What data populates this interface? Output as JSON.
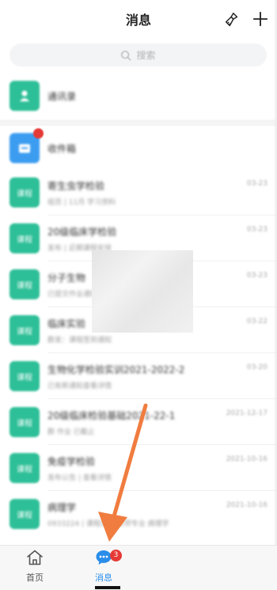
{
  "header": {
    "title": "消息"
  },
  "search": {
    "placeholder": "搜索"
  },
  "contacts": {
    "title": "通讯录"
  },
  "files": {
    "title": "收件箱"
  },
  "groups": [
    {
      "title": "寄生虫学检验",
      "sub": "组员 | 11月 学习资料",
      "date": "03-23",
      "icon_text": "课程"
    },
    {
      "title": "20级临床学检验",
      "sub": "发布 | 近期课程安排",
      "date": "03-23",
      "icon_text": "课程"
    },
    {
      "title": "分子生物",
      "sub": "已提交作业通知",
      "date": "03-23",
      "icon_text": "课程"
    },
    {
      "title": "临床实验",
      "sub": "群发：课程签到通知",
      "date": "03-22",
      "icon_text": "课程"
    },
    {
      "title": "生物化学检验实训2021-2022-2",
      "sub": "已有新通知查看详情",
      "date": "03-20",
      "icon_text": "课程"
    },
    {
      "title": "20级临床检验基础2021-22-1",
      "sub": "群 作业 已截止",
      "date": "2021-12-17",
      "icon_text": "课程"
    },
    {
      "title": "免疫学检验",
      "sub": "发布公告 | 查看详情",
      "date": "2021-10-16",
      "icon_text": "课程"
    },
    {
      "title": "病理学",
      "sub": "0933224 | 课程资料 老师专业 病理学",
      "date": "2021-10-16",
      "icon_text": "课程"
    }
  ],
  "tabbar": {
    "home_label": "首页",
    "msg_label": "消息",
    "msg_badge": "3"
  },
  "colors": {
    "accent_green": "#2dbf97",
    "accent_blue": "#2a8de9",
    "badge_red": "#e53935",
    "arrow_orange": "#f07c3f"
  }
}
